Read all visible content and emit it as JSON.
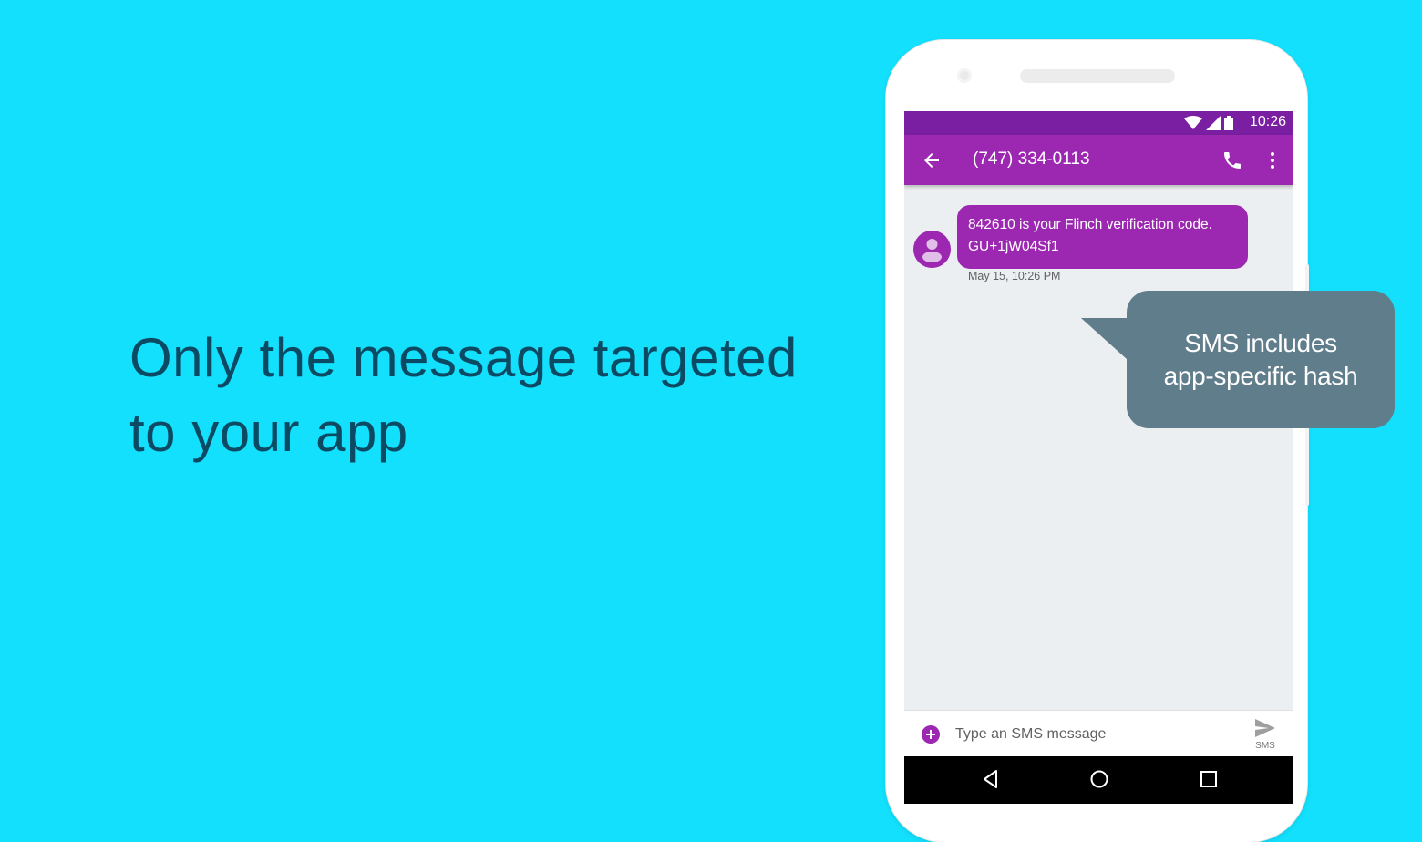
{
  "headline": {
    "line1": "Only the message targeted",
    "line2": "to your app"
  },
  "status_bar": {
    "time": "10:26",
    "icons": [
      "wifi-icon",
      "cell-signal-icon",
      "battery-icon"
    ]
  },
  "app_bar": {
    "title": "(747) 334-0113",
    "icons": [
      "back-arrow-icon",
      "phone-call-icon",
      "more-vert-icon"
    ]
  },
  "conversation": {
    "messages": [
      {
        "line1": "842610 is your Flinch verification code.",
        "line2": "GU+1jW04Sf1",
        "timestamp": "May 15, 10:26 PM"
      }
    ]
  },
  "composer": {
    "placeholder": "Type an SMS message",
    "send_label": "SMS"
  },
  "callout": {
    "line1": "SMS includes",
    "line2": "app-specific hash"
  },
  "colors": {
    "background": "#12e0fd",
    "headline": "#0c4a63",
    "status_bar": "#7b1fa2",
    "app_bar": "#9c27b0",
    "bubble": "#9c27b0",
    "callout": "#607d8b"
  }
}
